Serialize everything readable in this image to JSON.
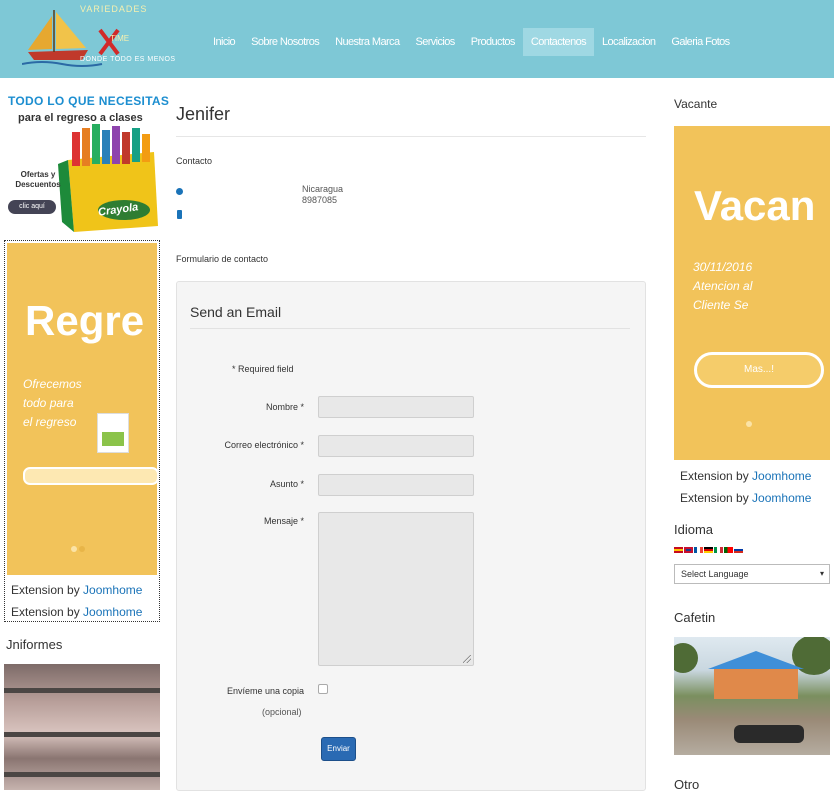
{
  "site": {
    "logo_line1": "VARIEDADES",
    "logo_line2": "TIME",
    "logo_tagline": "DONDE TODO ES MENOS"
  },
  "nav": {
    "items": [
      {
        "label": "Inicio",
        "active": false
      },
      {
        "label": "Sobre Nosotros",
        "active": false
      },
      {
        "label": "Nuestra Marca",
        "active": false
      },
      {
        "label": "Servicios",
        "active": false
      },
      {
        "label": "Productos",
        "active": false
      },
      {
        "label": "Contactenos",
        "active": true
      },
      {
        "label": "Localizacion",
        "active": false
      },
      {
        "label": "Galeria Fotos",
        "active": false
      }
    ]
  },
  "left": {
    "promo_title": "TODO LO QUE NECESITAS",
    "promo_subtitle": "para el regreso a clases",
    "promo_offer": "Ofertas y Descuentos",
    "promo_button": "clic aquí",
    "promo_brand": "Crayola",
    "slide_heading": "Regre",
    "slide_text": [
      "Ofrecemos",
      "todo para",
      "el regreso"
    ],
    "extensions": [
      {
        "prefix": "Extension by ",
        "link": "Joomhome"
      },
      {
        "prefix": "Extension by ",
        "link": "Joomhome"
      }
    ],
    "uniformes_title": "Jniformes"
  },
  "contact": {
    "name": "Jenifer",
    "contact_heading": "Contacto",
    "country": "Nicaragua",
    "phone": "8987085",
    "form_heading": "Formulario de contacto",
    "email_title": "Send an Email",
    "required_note": "* Required field",
    "fields": {
      "nombre": "Nombre *",
      "correo": "Correo electrónico *",
      "asunto": "Asunto *",
      "mensaje": "Mensaje *"
    },
    "copy_label": "Envíeme una copia",
    "copy_optional": "(opcional)",
    "send_button": "Enviar"
  },
  "right": {
    "vacante_title": "Vacante",
    "vac_heading": "Vacan",
    "vac_lines": [
      "30/11/2016",
      "Atencion al",
      "Cliente Se"
    ],
    "vac_button": "Mas...!",
    "extensions": [
      {
        "prefix": "Extension by ",
        "link": "Joomhome"
      },
      {
        "prefix": "Extension by ",
        "link": "Joomhome"
      }
    ],
    "idioma_title": "Idioma",
    "language_select": "Select Language",
    "cafetin_title": "Cafetin",
    "otro_title": "Otro"
  },
  "colors": {
    "header_bg": "#7ec8d6",
    "banner_yellow": "#f2c35a",
    "link_blue": "#1a73b8",
    "button_blue": "#2a6ab3"
  }
}
